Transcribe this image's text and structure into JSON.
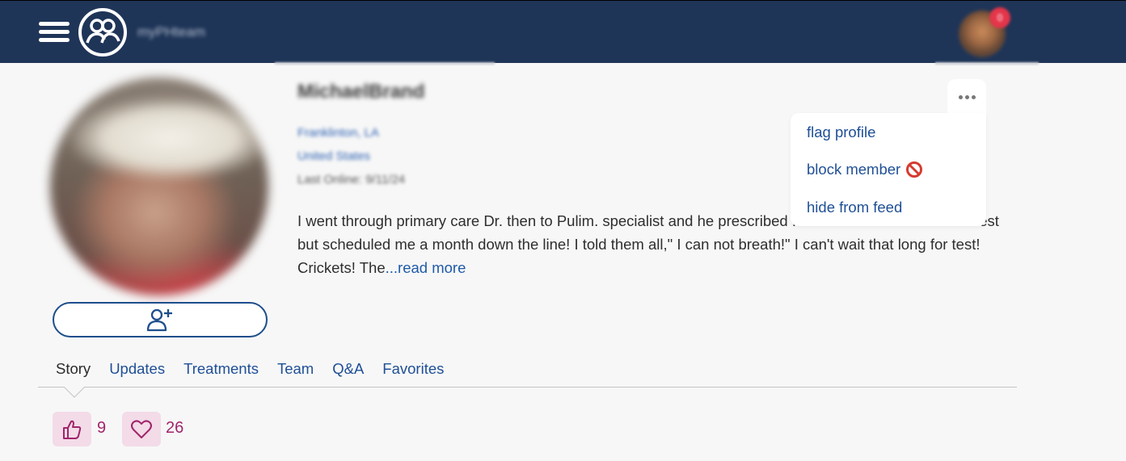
{
  "header": {
    "brand": "myPHteam",
    "notification_count": "0"
  },
  "profile": {
    "name": "MichaelBrand",
    "city": "Franklinton, LA",
    "country": "United States",
    "last_online": "Last Online: 9/11/24",
    "story": "I went through primary care Dr. then to Pulim. specialist and he prescribed ... Dr. wanted to do a catho test but scheduled me a month down the line! I told them all,\" I can not breath!\" I can't wait that long for test! Crickets! The",
    "read_more": "...read more"
  },
  "menu": {
    "items": [
      {
        "label": "flag profile"
      },
      {
        "label": "block member"
      },
      {
        "label": "hide from feed"
      }
    ]
  },
  "tabs": [
    {
      "label": "Story",
      "active": true
    },
    {
      "label": "Updates"
    },
    {
      "label": "Treatments"
    },
    {
      "label": "Team"
    },
    {
      "label": "Q&A"
    },
    {
      "label": "Favorites"
    }
  ],
  "reactions": {
    "likes": "9",
    "hearts": "26"
  },
  "colors": {
    "header_bg": "#1f3558",
    "link": "#1f4f96",
    "reaction": "#a0256a",
    "reaction_bg": "#f3dbe8"
  }
}
